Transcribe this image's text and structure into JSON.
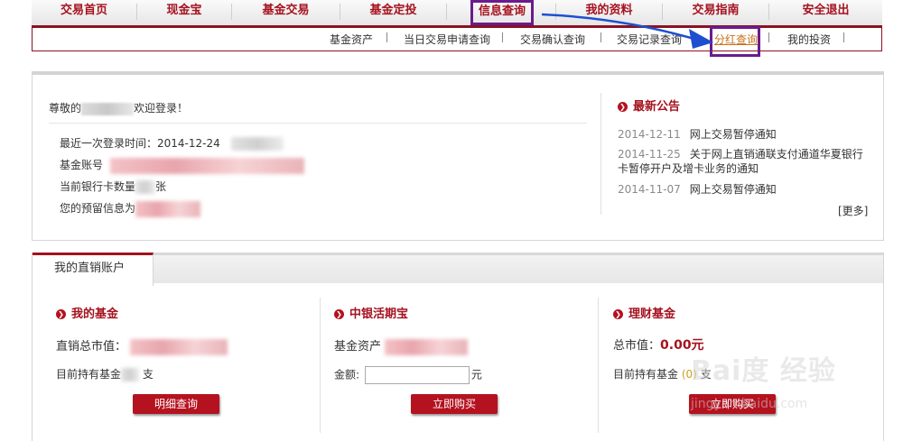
{
  "nav": {
    "items": [
      "交易首页",
      "现金宝",
      "基金交易",
      "基金定投",
      "信息查询",
      "我的资料",
      "交易指南",
      "安全退出"
    ],
    "highlighted": "信息查询"
  },
  "subnav": {
    "items": [
      "基金资产",
      "当日交易申请查询",
      "交易确认查询",
      "交易记录查询",
      "分红查询",
      "我的投资"
    ],
    "highlighted": "分红查询",
    "separator": "|"
  },
  "welcome": {
    "prefix": "尊敬的",
    "suffix": "欢迎登录！",
    "last_login_label": "最近一次登录时间：",
    "last_login_date": "2014-12-24",
    "account_label": "基金账号",
    "bank_count_label": "当前银行卡数量",
    "bank_count_unit": "张",
    "reserved_info_label": "您的预留信息为"
  },
  "notices": {
    "title": "最新公告",
    "items": [
      {
        "date": "2014-12-11",
        "text": "网上交易暂停通知"
      },
      {
        "date": "2014-11-25",
        "text": "关于网上直销通联支付通道华夏银行卡暂停开户及增卡业务的通知"
      },
      {
        "date": "2014-11-07",
        "text": "网上交易暂停通知"
      }
    ],
    "more": "[更多]"
  },
  "account": {
    "tab": "我的直销账户",
    "my_funds": {
      "title": "我的基金",
      "total_label": "直销总市值：",
      "holding_label": "目前持有基金",
      "holding_unit": "支",
      "button": "明细查询"
    },
    "cash": {
      "title": "中银活期宝",
      "asset_label": "基金资产",
      "amount_label": "金额:",
      "amount_unit": "元",
      "amount_placeholder": "",
      "button": "立即购买"
    },
    "wealth": {
      "title": "理财基金",
      "total_label": "总市值：",
      "total_value": "0.00元",
      "holding_label": "目前持有基金",
      "holding_count": "0",
      "holding_unit": "支",
      "button": "立即购买"
    }
  },
  "watermark": {
    "text": "Bai度 经验",
    "url": "jingyan.baidu.com"
  },
  "colors": {
    "brand": "#a5121f",
    "annotation": "#6a1b8c",
    "arrow": "#1e4fd0"
  }
}
